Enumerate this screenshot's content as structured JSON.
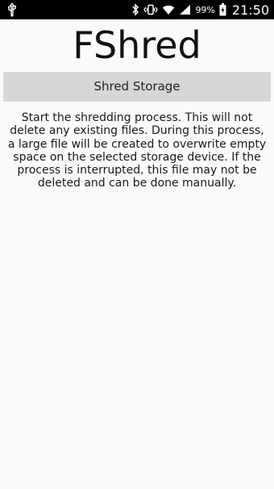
{
  "status_bar": {
    "battery_percent": "99%",
    "time": "21:50",
    "icons": [
      "usb-icon",
      "bluetooth-icon",
      "vibrate-icon",
      "wifi-icon",
      "signal-icon",
      "battery-icon"
    ]
  },
  "app": {
    "title": "FShred",
    "shred_button_label": "Shred Storage",
    "description": "Start the shredding process. This will not delete any existing files. During this process, a large file will be created to overwrite empty space on the selected storage device. If the process is interrupted, this file may not be deleted and can be done manually."
  }
}
